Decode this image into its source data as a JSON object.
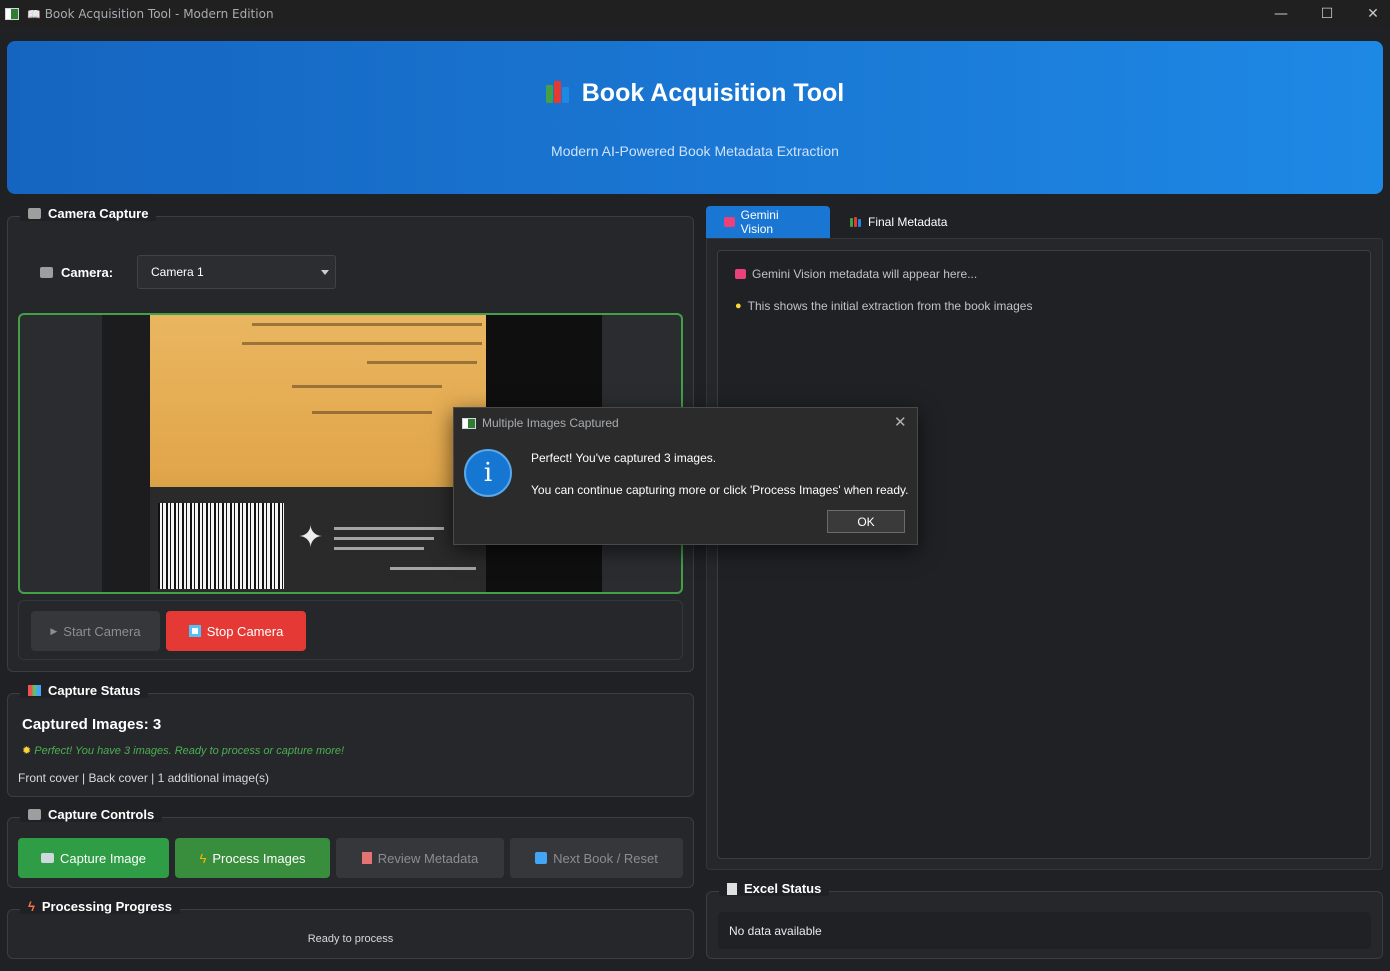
{
  "window": {
    "title": "Book Acquisition Tool - Modern Edition",
    "controls": {
      "minimize": "—",
      "maximize": "☐",
      "close": "✕"
    }
  },
  "header": {
    "title": "Book Acquisition Tool",
    "subtitle": "Modern AI-Powered Book Metadata Extraction"
  },
  "camera_capture": {
    "group_title": "Camera Capture",
    "camera_label": "Camera:",
    "camera_selected": "Camera 1",
    "start_button": "Start Camera",
    "stop_button": "Stop Camera"
  },
  "capture_status": {
    "group_title": "Capture Status",
    "captured_count_text": "Captured Images: 3",
    "message": "Perfect! You have 3 images. Ready to process or capture more!",
    "detail": "Front cover | Back cover | 1 additional image(s)"
  },
  "capture_controls": {
    "group_title": "Capture Controls",
    "capture_button": "Capture Image",
    "process_button": "Process Images",
    "review_button": "Review Metadata",
    "next_button": "Next Book / Reset"
  },
  "processing_progress": {
    "group_title": "Processing Progress",
    "status": "Ready to process"
  },
  "tabs": {
    "gemini": "Gemini Vision",
    "final": "Final Metadata"
  },
  "gemini_pane": {
    "line1": "Gemini Vision metadata will appear here...",
    "line2": "This shows the initial extraction from the book images"
  },
  "excel_status": {
    "group_title": "Excel Status",
    "text": "No data available"
  },
  "dialog": {
    "title": "Multiple Images Captured",
    "message1": "Perfect! You've captured 3 images.",
    "message2": "You can continue capturing more or click 'Process Images' when ready.",
    "ok_button": "OK"
  },
  "colors": {
    "header_start": "#1565c0",
    "header_end": "#1e88e5",
    "accent_green": "#2e9d46",
    "accent_red": "#e53935",
    "tab_active": "#1976d2"
  }
}
